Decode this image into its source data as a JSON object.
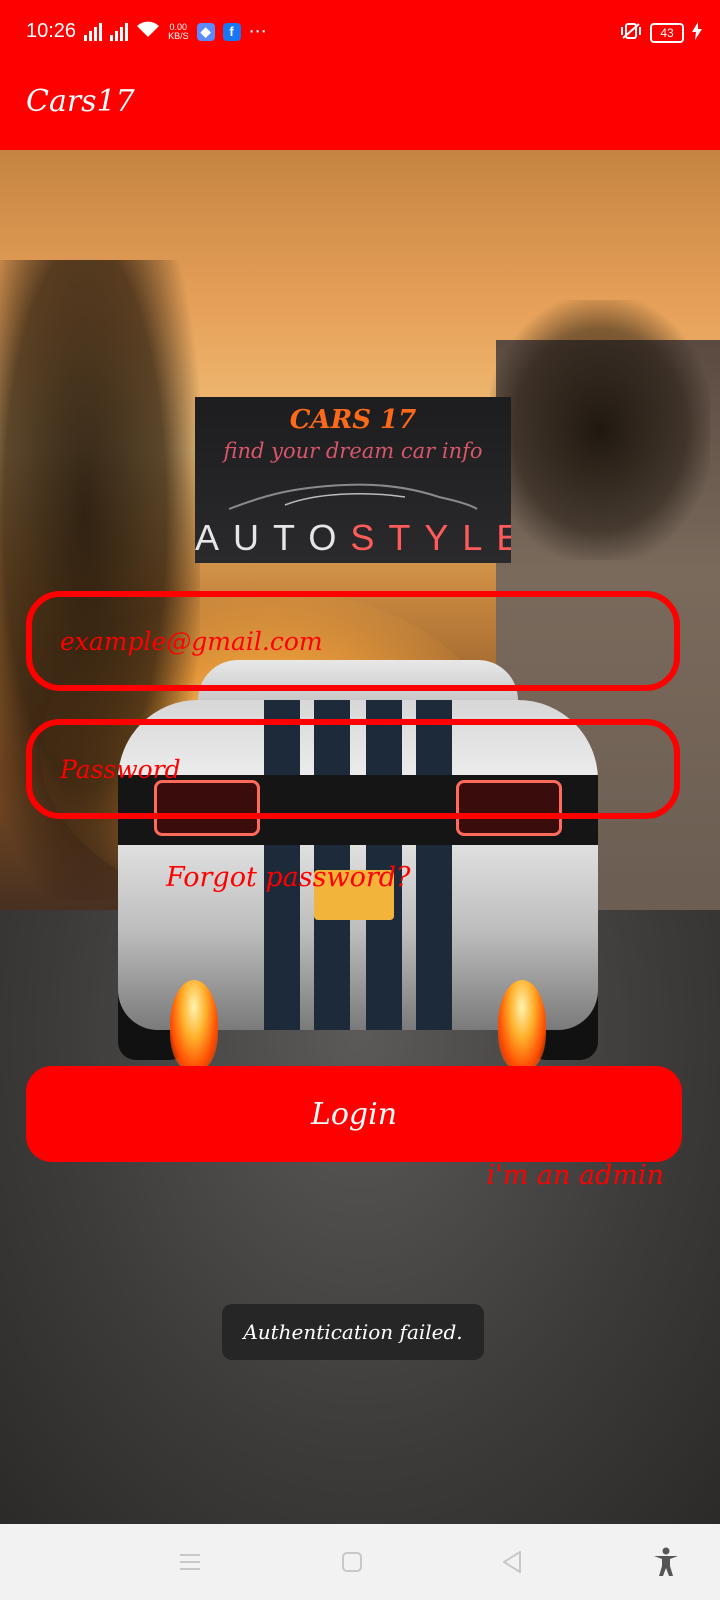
{
  "status_bar": {
    "time": "10:26",
    "net_speed_value": "0.00",
    "net_speed_unit": "KB/S",
    "more": "···",
    "battery_level": "43",
    "icons": [
      "signal-icon",
      "signal-icon",
      "wifi-icon",
      "app-notification-icon",
      "facebook-icon",
      "vibrate-icon",
      "battery-icon",
      "charging-icon"
    ]
  },
  "app_bar": {
    "title": "Cars17"
  },
  "logo": {
    "title": "CARS 17",
    "tagline": "find your dream car info",
    "sub_a": "AUTO",
    "sub_b": "STYLE"
  },
  "form": {
    "email_placeholder": "example@gmail.com",
    "password_placeholder": "Password",
    "forgot_label": "Forgot password?",
    "login_label": "Login",
    "admin_label": "i'm an admin"
  },
  "toast": {
    "text": "Authentication failed."
  },
  "colors": {
    "accent": "#ff0000",
    "toast_bg": "#262626",
    "nav_bg": "#f2f2f2"
  },
  "nav_bar": {
    "icons": [
      "menu-icon",
      "home-icon",
      "back-icon",
      "accessibility-icon"
    ]
  }
}
